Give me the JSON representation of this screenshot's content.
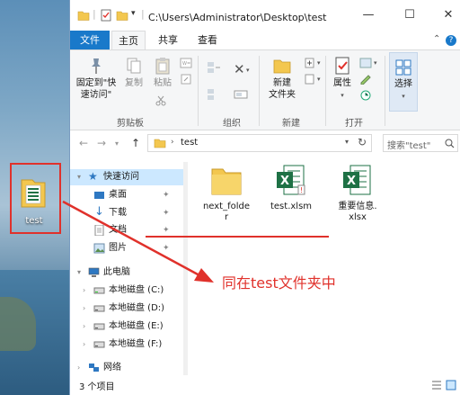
{
  "desktop": {
    "icon_label": "test"
  },
  "window": {
    "title_path": "C:\\Users\\Administrator\\Desktop\\test",
    "minimize": "—",
    "maximize": "☐",
    "close": "✕"
  },
  "menu": {
    "file": "文件",
    "tabs": [
      "主页",
      "共享",
      "查看"
    ]
  },
  "ribbon": {
    "pin_quick_access": [
      "固定到\"快",
      "速访问\""
    ],
    "copy": "复制",
    "paste": "粘贴",
    "clipboard_group": "剪贴板",
    "organize_group": "组织",
    "new_folder": [
      "新建",
      "文件夹"
    ],
    "new_group": "新建",
    "properties": "属性",
    "open_group": "打开",
    "select": "选择"
  },
  "navbar": {
    "address": "test",
    "search_placeholder": "搜索\"test\""
  },
  "nav_pane": {
    "quick_access": "快速访问",
    "desktop": "桌面",
    "downloads": "下载",
    "documents": "文档",
    "pictures": "图片",
    "this_pc": "此电脑",
    "disk_c": "本地磁盘 (C:)",
    "disk_d": "本地磁盘 (D:)",
    "disk_e": "本地磁盘 (E:)",
    "disk_f": "本地磁盘 (F:)",
    "network": "网络"
  },
  "files": {
    "folder": [
      "next_folde",
      "r"
    ],
    "xlsm": "test.xlsm",
    "xlsx": [
      "重要信息.",
      "xlsx"
    ]
  },
  "status": {
    "count": "3 个项目"
  },
  "annotation": {
    "text": "同在test文件夹中"
  },
  "colors": {
    "accent": "#1979ca",
    "annotation_red": "#e0312b",
    "excel_green": "#1e7145",
    "folder_yellow": "#f3c74f"
  }
}
